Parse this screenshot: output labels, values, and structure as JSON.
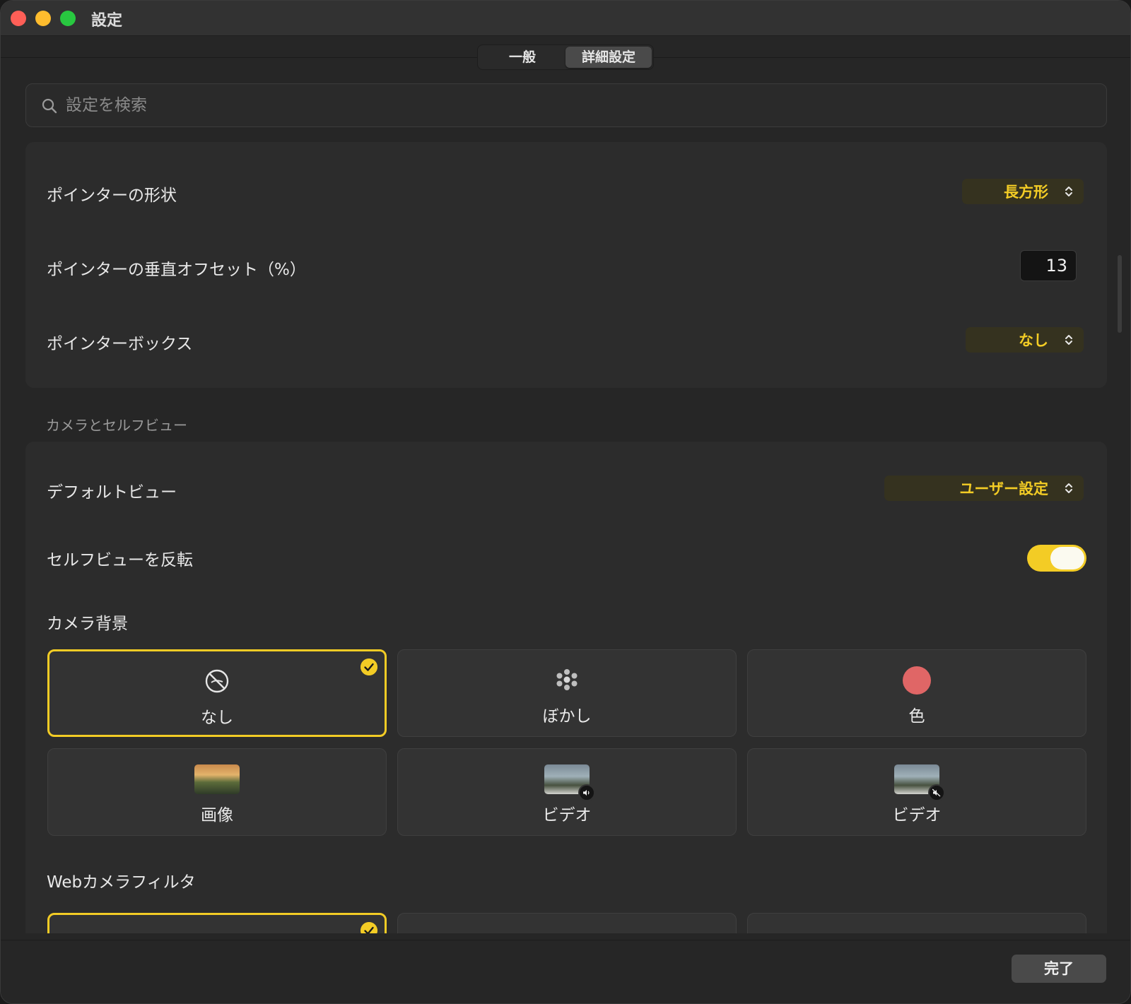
{
  "window": {
    "title": "設定"
  },
  "tabs": [
    {
      "label": "一般",
      "active": false
    },
    {
      "label": "詳細設定",
      "active": true
    }
  ],
  "search": {
    "placeholder": "設定を検索",
    "value": ""
  },
  "pointer_group": {
    "shape": {
      "label": "ポインターの形状",
      "value": "長方形"
    },
    "offset": {
      "label": "ポインターの垂直オフセット（%）",
      "value": "13"
    },
    "box": {
      "label": "ポインターボックス",
      "value": "なし"
    }
  },
  "camera_section": {
    "header": "カメラとセルフビュー",
    "default_view": {
      "label": "デフォルトビュー",
      "value": "ユーザー設定"
    },
    "mirror": {
      "label": "セルフビューを反転",
      "on": true
    },
    "background": {
      "label": "カメラ背景",
      "options": [
        {
          "label": "なし",
          "icon": "no-background-icon",
          "selected": true
        },
        {
          "label": "ぼかし",
          "icon": "blur-icon",
          "selected": false
        },
        {
          "label": "色",
          "icon": "color-circle-icon",
          "color": "#e06666",
          "selected": false
        },
        {
          "label": "画像",
          "icon": "image-thumbnail",
          "selected": false
        },
        {
          "label": "ビデオ",
          "icon": "video-with-sound-thumbnail",
          "selected": false
        },
        {
          "label": "ビデオ",
          "icon": "video-muted-thumbnail",
          "selected": false
        }
      ]
    },
    "filter": {
      "label": "Webカメラフィルタ"
    }
  },
  "footer": {
    "done_label": "完了"
  },
  "colors": {
    "accent": "#f3cc25",
    "background": "#262626",
    "group": "#2c2c2c"
  }
}
